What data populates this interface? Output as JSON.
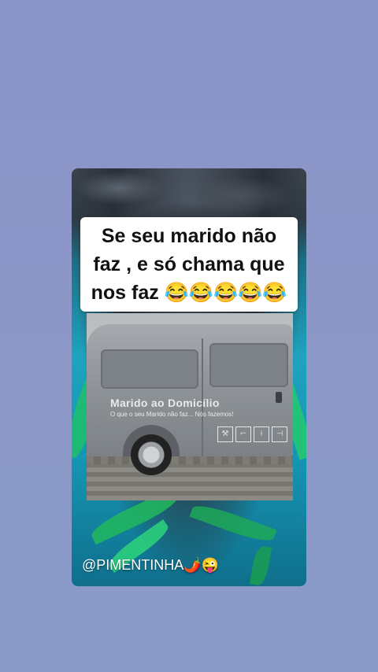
{
  "caption": {
    "line1": "Se seu marido não",
    "line2": "faz , e só chama que",
    "line3": "nos faz 😂😂😂😂😂"
  },
  "van": {
    "title": "Marido ao Domicílio",
    "subtitle": "O que o seu Marido não faz... Nós fazemos!"
  },
  "watermark": "@PIMENTINHA🌶️😜"
}
